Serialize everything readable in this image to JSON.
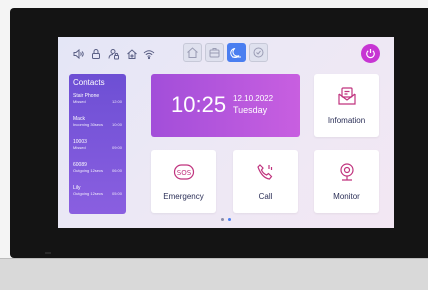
{
  "status_bar": {
    "icons": [
      "volume-icon",
      "lock-icon",
      "user-lock-icon",
      "home-outline-icon",
      "wifi-icon"
    ],
    "mode_tabs": [
      {
        "icon": "home-icon",
        "active": false
      },
      {
        "icon": "briefcase-icon",
        "active": false
      },
      {
        "icon": "moon-icon",
        "active": true
      },
      {
        "icon": "check-icon",
        "active": false
      }
    ],
    "power_icon": "power-icon",
    "colors": {
      "accent": "#4a7ef0",
      "power": "#c735d3"
    }
  },
  "contacts": {
    "title": "Contacts",
    "items": [
      {
        "name": "Stair Phone",
        "status": "Missed",
        "time": "12:00"
      },
      {
        "name": "Mack",
        "status": "Incoming 30secs",
        "time": "10:00"
      },
      {
        "name": "10003",
        "status": "Missed",
        "time": "09:00"
      },
      {
        "name": "60089",
        "status": "Outgoing 12secs",
        "time": "06:00"
      },
      {
        "name": "Lily",
        "status": "Outgoing 12secs",
        "time": "05:00"
      }
    ]
  },
  "clock": {
    "time": "10:25",
    "date": "12.10.2022",
    "day": "Tuesday"
  },
  "tiles": {
    "information": {
      "label": "Infomation",
      "icon": "envelope-icon"
    },
    "emergency": {
      "label": "Emergency",
      "icon": "sos-icon"
    },
    "call": {
      "label": "Call",
      "icon": "phone-icon"
    },
    "monitor": {
      "label": "Monitor",
      "icon": "camera-icon"
    }
  },
  "pagination": {
    "pages": 2,
    "current": 1
  }
}
